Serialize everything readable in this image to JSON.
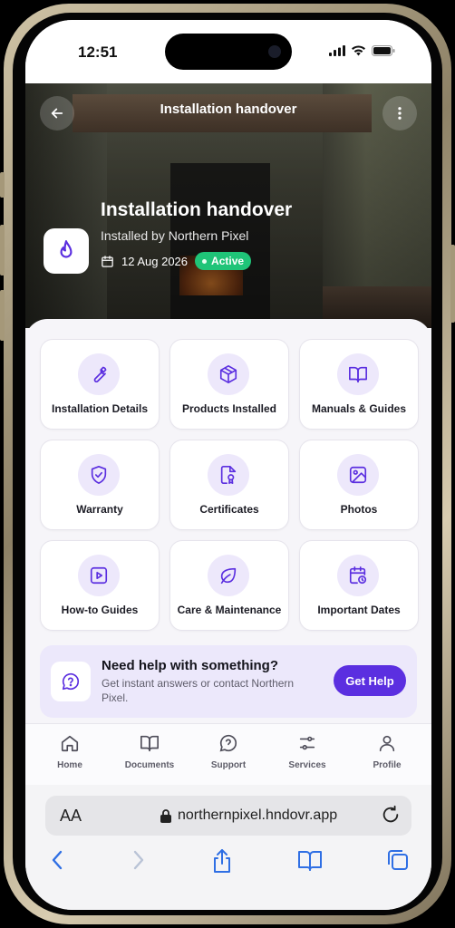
{
  "status_bar": {
    "time": "12:51"
  },
  "header": {
    "title": "Installation handover",
    "back_icon": "arrow-left-icon",
    "menu_icon": "more-vertical-icon"
  },
  "hero": {
    "title": "Installation handover",
    "subtitle": "Installed by Northern Pixel",
    "date": "12 Aug 2026",
    "status": "Active",
    "status_color": "#1fc478",
    "logo_icon": "flame-icon"
  },
  "tiles": [
    {
      "label": "Installation Details",
      "icon": "wrench-icon"
    },
    {
      "label": "Products Installed",
      "icon": "box-icon"
    },
    {
      "label": "Manuals & Guides",
      "icon": "book-open-icon"
    },
    {
      "label": "Warranty",
      "icon": "shield-check-icon"
    },
    {
      "label": "Certificates",
      "icon": "certificate-icon"
    },
    {
      "label": "Photos",
      "icon": "image-icon"
    },
    {
      "label": "How-to Guides",
      "icon": "play-icon"
    },
    {
      "label": "Care & Maintenance",
      "icon": "leaf-icon"
    },
    {
      "label": "Important Dates",
      "icon": "calendar-clock-icon"
    }
  ],
  "help": {
    "title": "Need help with something?",
    "text": "Get instant answers or contact Northern Pixel.",
    "button": "Get Help",
    "accent": "#5b2fe0"
  },
  "nav": [
    {
      "label": "Home",
      "icon": "home-icon"
    },
    {
      "label": "Documents",
      "icon": "book-icon"
    },
    {
      "label": "Support",
      "icon": "help-circle-icon"
    },
    {
      "label": "Services",
      "icon": "sliders-icon"
    },
    {
      "label": "Profile",
      "icon": "user-icon"
    }
  ],
  "browser": {
    "aa": "AA",
    "url": "northernpixel.hndovr.app"
  }
}
